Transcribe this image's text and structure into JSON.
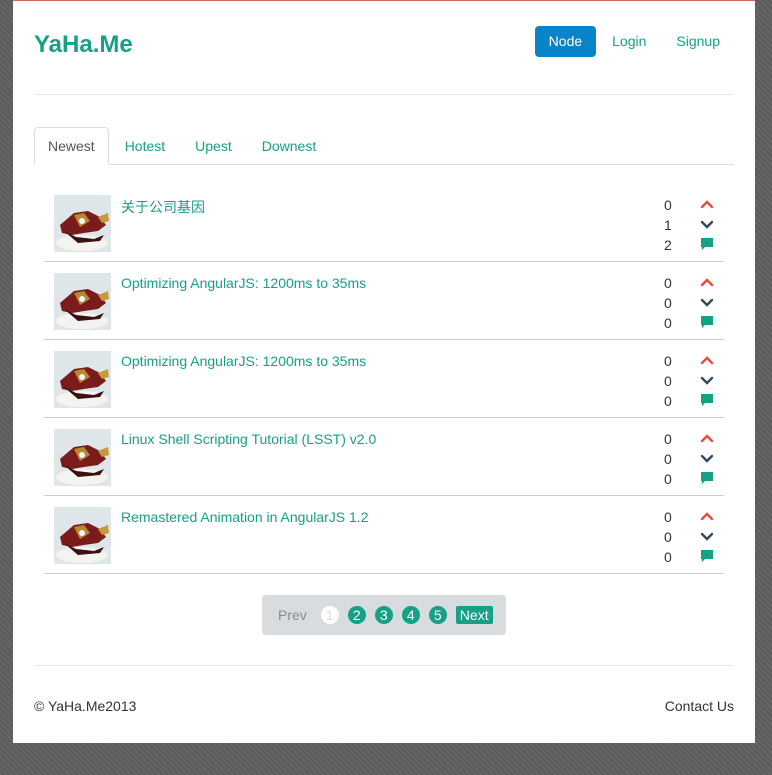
{
  "header": {
    "brand": "YaHa.Me",
    "nav": [
      {
        "label": "Node",
        "active": true
      },
      {
        "label": "Login",
        "active": false
      },
      {
        "label": "Signup",
        "active": false
      }
    ]
  },
  "tabs": [
    {
      "label": "Newest",
      "active": true
    },
    {
      "label": "Hotest",
      "active": false
    },
    {
      "label": "Upest",
      "active": false
    },
    {
      "label": "Downest",
      "active": false
    }
  ],
  "posts": [
    {
      "title": "关于公司基因",
      "up": "0",
      "down": "1",
      "comments": "2"
    },
    {
      "title": "Optimizing AngularJS: 1200ms to 35ms",
      "up": "0",
      "down": "0",
      "comments": "0"
    },
    {
      "title": "Optimizing AngularJS: 1200ms to 35ms",
      "up": "0",
      "down": "0",
      "comments": "0"
    },
    {
      "title": "Linux Shell Scripting Tutorial (LSST) v2.0",
      "up": "0",
      "down": "0",
      "comments": "0"
    },
    {
      "title": "Remastered Animation in AngularJS 1.2",
      "up": "0",
      "down": "0",
      "comments": "0"
    }
  ],
  "icons": {
    "up": "chevron-up-icon",
    "down": "chevron-down-icon",
    "comment": "comment-icon",
    "thumb": "ironman-avatar"
  },
  "pagination": {
    "prev": "Prev",
    "pages": [
      "1",
      "2",
      "3",
      "4",
      "5"
    ],
    "current": "1",
    "next": "Next"
  },
  "footer": {
    "copyright": "© YaHa.Me2013",
    "contact": "Contact Us"
  },
  "colors": {
    "accent": "#16a085",
    "nav_active": "#0a84c9",
    "upvote": "#e74c3c",
    "downvote": "#34495e",
    "background": "#5f5f5f"
  }
}
